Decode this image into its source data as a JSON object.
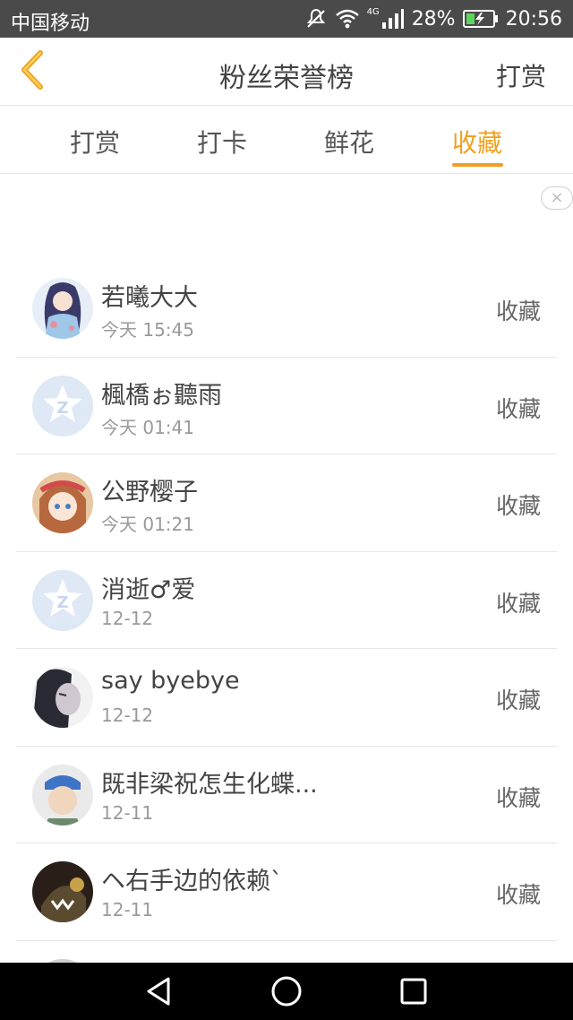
{
  "status_bar": {
    "carrier": "中国移动",
    "network_tag": "4G",
    "battery_percent": "28%",
    "time": "20:56",
    "icons": [
      "mute-icon",
      "wifi-icon",
      "signal-icon",
      "battery-charging-icon"
    ]
  },
  "header": {
    "title": "粉丝荣誉榜",
    "right_action": "打赏",
    "back_icon": "chevron-left-icon"
  },
  "tabs": [
    {
      "label": "打赏",
      "active": false
    },
    {
      "label": "打卡",
      "active": false
    },
    {
      "label": "鲜花",
      "active": false
    },
    {
      "label": "收藏",
      "active": true
    }
  ],
  "colors": {
    "accent": "#f0a020",
    "status_bar": "#4a4a4a",
    "text": "#444444",
    "subtext": "#9a9a9a"
  },
  "ad_close_label": "×",
  "fans": [
    {
      "name": "若曦大大",
      "time": "今天 15:45",
      "action": "收藏",
      "avatar": "anime-girl-avatar"
    },
    {
      "name": "楓橋ぉ聽雨",
      "time": "今天 01:41",
      "action": "收藏",
      "avatar": "default-qzone-avatar"
    },
    {
      "name": "公野樱子",
      "time": "今天 01:21",
      "action": "收藏",
      "avatar": "anime-girl-avatar"
    },
    {
      "name": "消逝♂爱",
      "time": "12-12",
      "action": "收藏",
      "avatar": "default-qzone-avatar"
    },
    {
      "name": "say byebye",
      "time": "12-12",
      "action": "收藏",
      "avatar": "dark-portrait-avatar"
    },
    {
      "name": "既非梁祝怎生化蝶...",
      "time": "12-11",
      "action": "收藏",
      "avatar": "child-photo-avatar"
    },
    {
      "name": "ヘ右手边的依赖ˋ",
      "time": "12-11",
      "action": "收藏",
      "avatar": "dark-creature-avatar"
    }
  ],
  "nav_bar": {
    "icons": [
      "back-triangle-icon",
      "home-circle-icon",
      "recents-square-icon"
    ]
  }
}
